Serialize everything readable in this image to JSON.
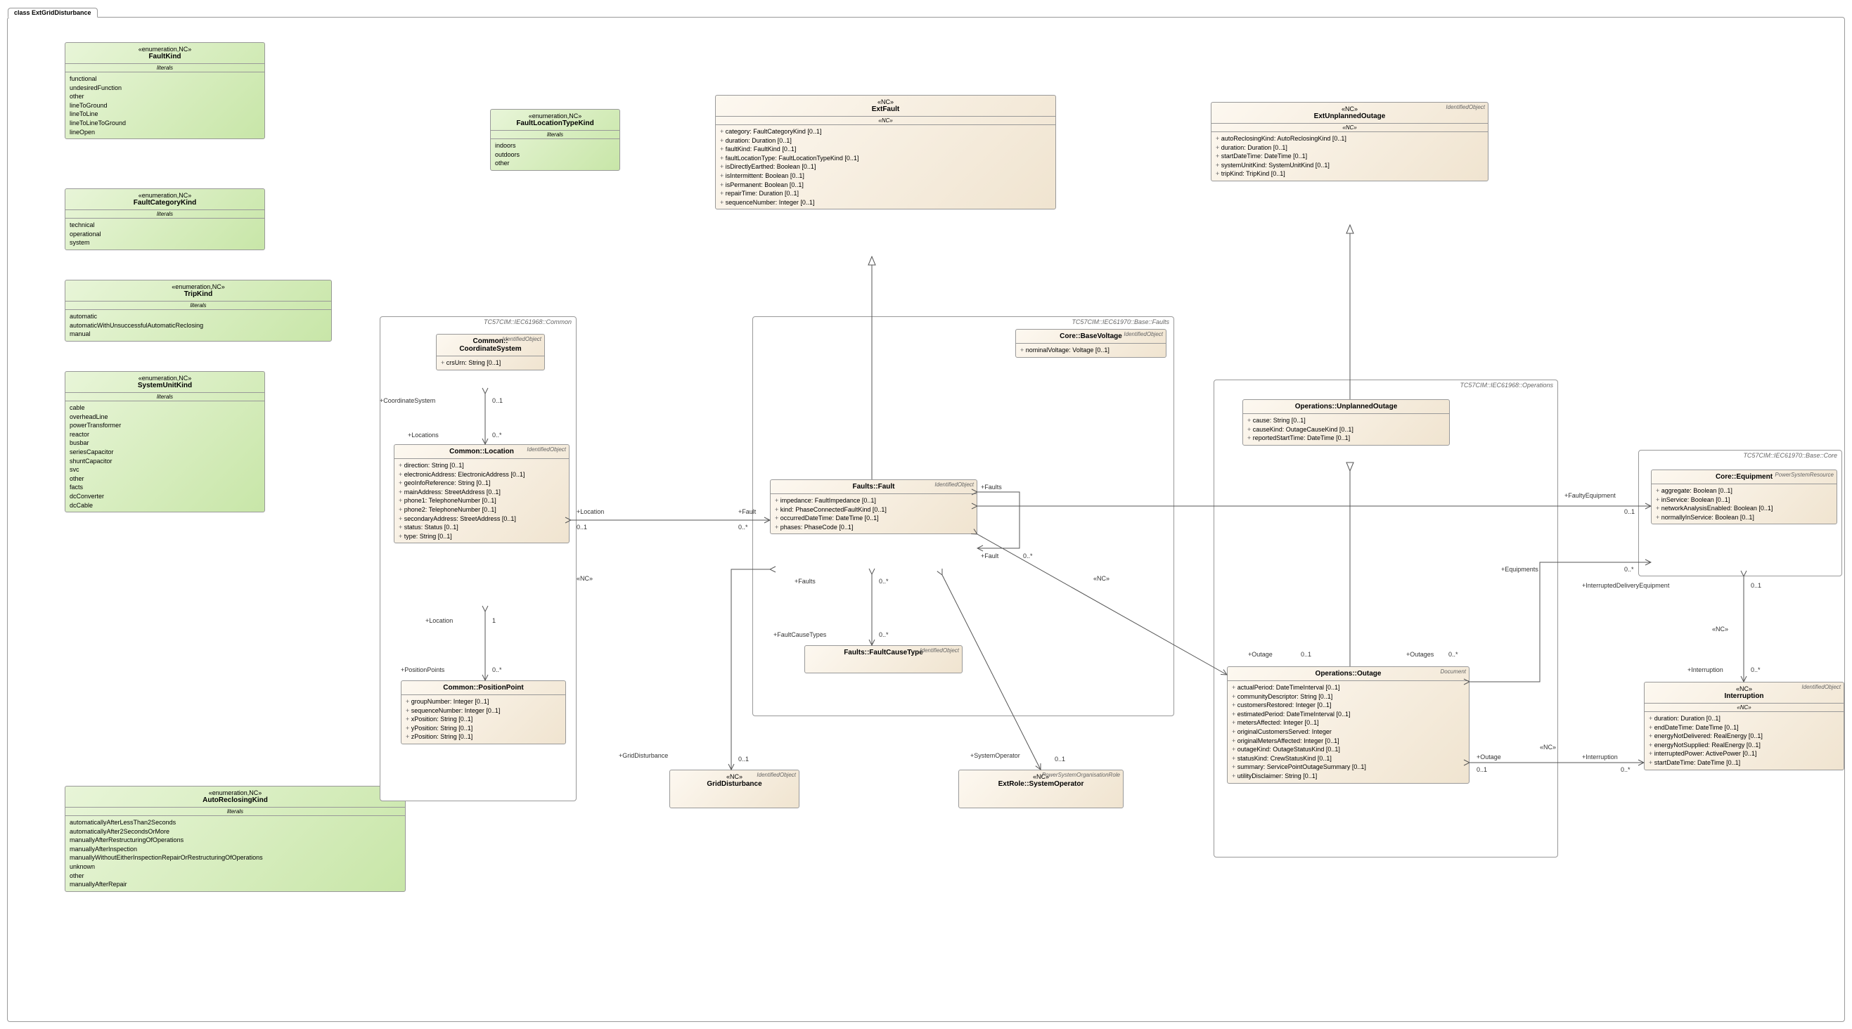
{
  "diagram_title": "class ExtGridDisturbance",
  "enums": {
    "FaultKind": {
      "stereo": "«enumeration,NC»",
      "literals": [
        "functional",
        "undesiredFunction",
        "other",
        "lineToGround",
        "lineToLine",
        "lineToLineToGround",
        "lineOpen"
      ]
    },
    "FaultCategoryKind": {
      "stereo": "«enumeration,NC»",
      "literals": [
        "technical",
        "operational",
        "system"
      ]
    },
    "TripKind": {
      "stereo": "«enumeration,NC»",
      "literals": [
        "automatic",
        "automaticWithUnsuccessfulAutomaticReclosing",
        "manual"
      ]
    },
    "SystemUnitKind": {
      "stereo": "«enumeration,NC»",
      "literals": [
        "cable",
        "overheadLine",
        "powerTransformer",
        "reactor",
        "busbar",
        "seriesCapacitor",
        "shuntCapacitor",
        "svc",
        "other",
        "facts",
        "dcConverter",
        "dcCable"
      ]
    },
    "AutoReclosingKind": {
      "stereo": "«enumeration,NC»",
      "literals": [
        "automaticallyAfterLessThan2Seconds",
        "automaticallyAfter2SecondsOrMore",
        "manuallyAfterRestructuringOfOperations",
        "manuallyAfterInspection",
        "manuallyWithoutEitherInspectionRepairOrRestructuringOfOperations",
        "unknown",
        "other",
        "manuallyAfterRepair"
      ]
    },
    "FaultLocationTypeKind": {
      "stereo": "«enumeration,NC»",
      "literals": [
        "indoors",
        "outdoors",
        "other"
      ]
    }
  },
  "classes": {
    "ExtFault": {
      "stereo": "«NC»",
      "section": "«NC»",
      "attrs": [
        "category: FaultCategoryKind [0..1]",
        "duration: Duration [0..1]",
        "faultKind: FaultKind [0..1]",
        "faultLocationType: FaultLocationTypeKind [0..1]",
        "isDirectlyEarthed: Boolean [0..1]",
        "isIntermittent: Boolean [0..1]",
        "isPermanent: Boolean [0..1]",
        "repairTime: Duration [0..1]",
        "sequenceNumber: Integer [0..1]"
      ]
    },
    "ExtUnplannedOutage": {
      "stereo": "«NC»",
      "section": "«NC»",
      "topStereo": "IdentifiedObject",
      "attrs": [
        "autoReclosingKind: AutoReclosingKind [0..1]",
        "duration: Duration [0..1]",
        "startDateTime: DateTime [0..1]",
        "systemUnitKind: SystemUnitKind [0..1]",
        "tripKind: TripKind [0..1]"
      ]
    },
    "CoordinateSystem": {
      "name": "Common::\nCoordinateSystem",
      "topStereo": "IdentifiedObject",
      "attrs": [
        "crsUrn: String [0..1]"
      ]
    },
    "Location": {
      "name": "Common::Location",
      "topStereo": "IdentifiedObject",
      "attrs": [
        "direction: String [0..1]",
        "electronicAddress: ElectronicAddress [0..1]",
        "geoInfoReference: String [0..1]",
        "mainAddress: StreetAddress [0..1]",
        "phone1: TelephoneNumber [0..1]",
        "phone2: TelephoneNumber [0..1]",
        "secondaryAddress: StreetAddress [0..1]",
        "status: Status [0..1]",
        "type: String [0..1]"
      ]
    },
    "PositionPoint": {
      "name": "Common::PositionPoint",
      "attrs": [
        "groupNumber: Integer [0..1]",
        "sequenceNumber: Integer [0..1]",
        "xPosition: String [0..1]",
        "yPosition: String [0..1]",
        "zPosition: String [0..1]"
      ]
    },
    "BaseVoltage": {
      "name": "Core::BaseVoltage",
      "topStereo": "IdentifiedObject",
      "attrs": [
        "nominalVoltage: Voltage [0..1]"
      ]
    },
    "Fault": {
      "name": "Faults::Fault",
      "topStereo": "IdentifiedObject",
      "attrs": [
        "impedance: FaultImpedance [0..1]",
        "kind: PhaseConnectedFaultKind [0..1]",
        "occurredDateTime: DateTime [0..1]",
        "phases: PhaseCode [0..1]"
      ]
    },
    "FaultCauseType": {
      "name": "Faults::FaultCauseType",
      "topStereo": "IdentifiedObject"
    },
    "UnplannedOutage": {
      "name": "Operations::UnplannedOutage",
      "attrs": [
        "cause: String [0..1]",
        "causeKind: OutageCauseKind [0..1]",
        "reportedStartTime: DateTime [0..1]"
      ]
    },
    "Outage": {
      "name": "Operations::Outage",
      "topStereo": "Document",
      "attrs": [
        "actualPeriod: DateTimeInterval [0..1]",
        "communityDescriptor: String [0..1]",
        "customersRestored: Integer [0..1]",
        "estimatedPeriod: DateTimeInterval [0..1]",
        "metersAffected: Integer [0..1]",
        "originalCustomersServed: Integer",
        "originalMetersAffected: Integer [0..1]",
        "outageKind: OutageStatusKind [0..1]",
        "statusKind: CrewStatusKind [0..1]",
        "summary: ServicePointOutageSummary [0..1]",
        "utilityDisclaimer: String [0..1]"
      ]
    },
    "Equipment": {
      "name": "Core::Equipment",
      "topStereo": "PowerSystemResource",
      "attrs": [
        "aggregate: Boolean [0..1]",
        "inService: Boolean [0..1]",
        "networkAnalysisEnabled: Boolean [0..1]",
        "normallyInService: Boolean [0..1]"
      ]
    },
    "Interruption": {
      "stereo": "«NC»",
      "section": "«NC»",
      "topStereo": "IdentifiedObject",
      "attrs": [
        "duration: Duration [0..1]",
        "endDateTime: DateTime [0..1]",
        "energyNotDelivered: RealEnergy [0..1]",
        "energyNotSupplied: RealEnergy [0..1]",
        "interruptedPower: ActivePower [0..1]",
        "startDateTime: DateTime [0..1]"
      ]
    },
    "GridDisturbance": {
      "stereo": "«NC»",
      "topStereo": "IdentifiedObject"
    },
    "SystemOperator": {
      "name": "ExtRole::SystemOperator",
      "stereo": "«NC»",
      "topStereo": "PowerSystemOrganisationRole"
    }
  },
  "packages": {
    "Common": "TC57CIM::IEC61968::Common",
    "Faults": "TC57CIM::IEC61970::Base::Faults",
    "Operations": "TC57CIM::IEC61968::Operations",
    "Core": "TC57CIM::IEC61970::Base::Core"
  },
  "roles": {
    "CoordinateSystem_role": "+CoordinateSystem",
    "CoordinateSystem_mult": "0..1",
    "Locations_role": "+Locations",
    "Locations_mult": "0..*",
    "Location_role": "+Location",
    "Location_mult": "1",
    "Location_mult01": "0..1",
    "PositionPoints_role": "+PositionPoints",
    "PositionPoints_mult": "0..*",
    "Fault_role": "+Fault",
    "Fault_mult": "0..*",
    "Faults_role": "+Faults",
    "Faults_mult": "0..*",
    "FaultCauseTypes_role": "+FaultCauseTypes",
    "FaultCauseTypes_mult": "0..*",
    "GridDisturbance_role": "+GridDisturbance",
    "GridDisturbance_mult": "0..1",
    "SystemOperator_role": "+SystemOperator",
    "SystemOperator_mult": "0..1",
    "FaultyEquipment_role": "+FaultyEquipment",
    "FaultyEquipment_mult": "0..1",
    "Equipments_role": "+Equipments",
    "Equipments_mult": "0..*",
    "Outage_role": "+Outage",
    "Outage_mult": "0..1",
    "Outages_role": "+Outages",
    "Outages_mult": "0..*",
    "Interruption_role": "+Interruption",
    "Interruption_mult": "0..*",
    "InterruptedDeliveryEquipment_role": "+InterruptedDeliveryEquipment",
    "InterruptedDeliveryEquipment_mult": "0..1",
    "NC_stereo": "«NC»"
  },
  "literals_label": "literals"
}
